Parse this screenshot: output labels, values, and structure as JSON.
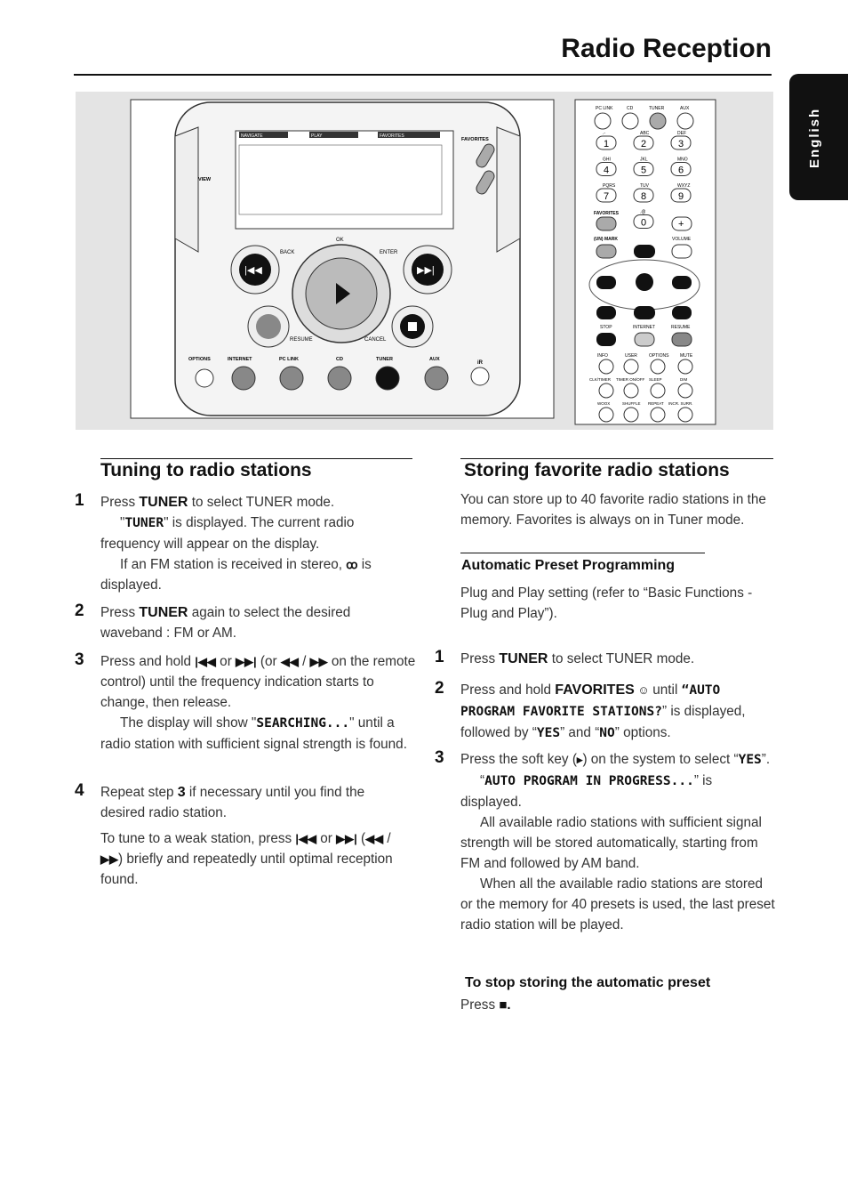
{
  "page": {
    "title": "Radio Reception",
    "language_tab": "English"
  },
  "figure": {
    "unit": {
      "view": "VIEW",
      "favorites": "FAVORITES",
      "back": "BACK",
      "ok": "OK",
      "enter": "ENTER",
      "resume": "RESUME",
      "cancel": "CANCEL",
      "display_tabs": [
        "NAVIGATE",
        "PLAY",
        "FAVORITES"
      ],
      "sources": [
        "OPTIONS",
        "INTERNET",
        "PC LINK",
        "CD",
        "TUNER",
        "AUX",
        "iR"
      ]
    },
    "remote": {
      "sources": [
        "PC LINK",
        "CD",
        "TUNER",
        "AUX"
      ],
      "keys": [
        {
          "sub": ".-",
          "key": "1"
        },
        {
          "sub": "ABC",
          "key": "2"
        },
        {
          "sub": "DEF",
          "key": "3"
        },
        {
          "sub": "GHI",
          "key": "4"
        },
        {
          "sub": "JKL",
          "key": "5"
        },
        {
          "sub": "MNO",
          "key": "6"
        },
        {
          "sub": "PQRS",
          "key": "7"
        },
        {
          "sub": "TUV",
          "key": "8"
        },
        {
          "sub": "WXYZ",
          "key": "9"
        },
        {
          "sub": ".@",
          "key": "0"
        }
      ],
      "favorites": "FAVORITES",
      "unmark": "(UN) MARK",
      "volume": "VOLUME",
      "row1": [
        "STOP",
        "INTERNET",
        "RESUME"
      ],
      "row2": [
        "INFO",
        "USER",
        "OPTIONS",
        "MUTE"
      ],
      "row3": [
        "CLK/TIMER",
        "TIMER ON/OFF",
        "SLEEP",
        "DIM"
      ],
      "row4": [
        "WOOX",
        "SHUFFLE",
        "REPEAT",
        "INCR. SURR."
      ]
    }
  },
  "left": {
    "heading": "Tuning to radio stations",
    "steps": [
      {
        "num": "1",
        "p": [
          {
            "ind": false,
            "s": [
              {
                "t": "Press ",
                "c": "n"
              },
              {
                "t": "TUNER",
                "c": "b"
              },
              {
                "t": " to select TUNER mode.",
                "c": "n"
              }
            ]
          },
          {
            "ind": true,
            "s": [
              {
                "t": "\"",
                "c": "n"
              },
              {
                "t": "TUNER",
                "c": "m"
              },
              {
                "t": "\" is displayed. The current radio frequency will appear on the display.",
                "c": "n"
              }
            ]
          },
          {
            "ind": true,
            "s": [
              {
                "t": "If an FM station is received in stereo, ",
                "c": "n"
              },
              {
                "t": "ꝏ",
                "c": "i"
              },
              {
                "t": " is displayed.",
                "c": "n"
              }
            ]
          }
        ]
      },
      {
        "num": "2",
        "p": [
          {
            "ind": false,
            "s": [
              {
                "t": "Press ",
                "c": "n"
              },
              {
                "t": "TUNER",
                "c": "b"
              },
              {
                "t": " again to select the desired waveband : FM or AM.",
                "c": "n"
              }
            ]
          }
        ]
      },
      {
        "num": "3",
        "p": [
          {
            "ind": false,
            "s": [
              {
                "t": "Press and hold ",
                "c": "n"
              },
              {
                "t": "|◀◀",
                "c": "i"
              },
              {
                "t": " or ",
                "c": "n"
              },
              {
                "t": "▶▶|",
                "c": "i"
              },
              {
                "t": " (or ",
                "c": "n"
              },
              {
                "t": "◀◀",
                "c": "i"
              },
              {
                "t": " / ",
                "c": "n"
              },
              {
                "t": "▶▶",
                "c": "i"
              },
              {
                "t": " on the remote control) until the frequency indication starts to change, then release.",
                "c": "n"
              }
            ]
          },
          {
            "ind": true,
            "s": [
              {
                "t": "The display will show \"",
                "c": "n"
              },
              {
                "t": "SEARCHING...",
                "c": "m"
              },
              {
                "t": "\" until a radio station with sufficient signal strength is found.",
                "c": "n"
              }
            ]
          }
        ]
      },
      {
        "num": "4",
        "p": [
          {
            "ind": false,
            "s": [
              {
                "t": "Repeat step ",
                "c": "n"
              },
              {
                "t": "3",
                "c": "b"
              },
              {
                "t": " if necessary until you find the desired radio station.",
                "c": "n"
              }
            ]
          }
        ]
      }
    ],
    "note": [
      {
        "t": "To tune to a weak station, press ",
        "c": "n"
      },
      {
        "t": "|◀◀",
        "c": "i"
      },
      {
        "t": " or ",
        "c": "n"
      },
      {
        "t": "▶▶|",
        "c": "i"
      },
      {
        "t": " (",
        "c": "n"
      },
      {
        "t": "◀◀",
        "c": "i"
      },
      {
        "t": " / ",
        "c": "n"
      },
      {
        "t": "▶▶",
        "c": "i"
      },
      {
        "t": ") briefly and repeatedly until optimal reception found.",
        "c": "n"
      }
    ]
  },
  "right": {
    "heading": "Storing favorite radio stations",
    "intro": "You can store up to 40 favorite radio stations in the memory. Favorites is always on in Tuner mode.",
    "subheading": "Automatic Preset Programming",
    "plug": "Plug and Play setting (refer to “Basic Functions - Plug and Play”).",
    "steps": [
      {
        "num": "1",
        "p": [
          {
            "ind": false,
            "s": [
              {
                "t": "Press ",
                "c": "n"
              },
              {
                "t": "TUNER",
                "c": "b"
              },
              {
                "t": " to select TUNER mode.",
                "c": "n"
              }
            ]
          }
        ]
      },
      {
        "num": "2",
        "p": [
          {
            "ind": false,
            "s": [
              {
                "t": "Press and hold ",
                "c": "n"
              },
              {
                "t": "FAVORITES",
                "c": "b"
              },
              {
                "t": " ☺ ",
                "c": "i"
              },
              {
                "t": "until ",
                "c": "n"
              },
              {
                "t": "“AUTO PROGRAM FAVORITE STATIONS?",
                "c": "m"
              },
              {
                "t": "” is displayed, followed by “",
                "c": "n"
              },
              {
                "t": "YES",
                "c": "m"
              },
              {
                "t": "” and “",
                "c": "n"
              },
              {
                "t": "NO",
                "c": "m"
              },
              {
                "t": "” options.",
                "c": "n"
              }
            ]
          }
        ]
      },
      {
        "num": "3",
        "p": [
          {
            "ind": false,
            "s": [
              {
                "t": "Press the soft key (",
                "c": "n"
              },
              {
                "t": "▸",
                "c": "i"
              },
              {
                "t": ") on the system to select “",
                "c": "n"
              },
              {
                "t": "YES",
                "c": "m"
              },
              {
                "t": "”.",
                "c": "n"
              }
            ]
          },
          {
            "ind": true,
            "s": [
              {
                "t": "“",
                "c": "n"
              },
              {
                "t": "AUTO PROGRAM IN PROGRESS...",
                "c": "m"
              },
              {
                "t": "” is displayed.",
                "c": "n"
              }
            ]
          },
          {
            "ind": true,
            "s": [
              {
                "t": "All available radio stations with sufficient signal strength will be stored automatically, starting from FM and followed by AM band.",
                "c": "n"
              }
            ]
          },
          {
            "ind": true,
            "s": [
              {
                "t": "When all the available radio stations are stored or the memory for 40 presets is used, the last preset radio station will be played.",
                "c": "n"
              }
            ]
          }
        ]
      }
    ],
    "stop_heading": "To stop storing the automatic preset",
    "stop_text": "Press",
    "stop_symbol": "■."
  }
}
